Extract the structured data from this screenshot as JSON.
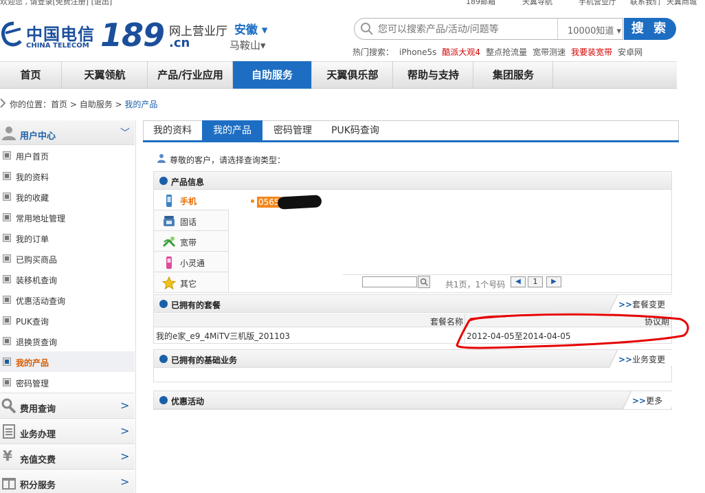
{
  "top_strip": {
    "items": [
      "欢迎您 , 请登录[免费注册] [退出]",
      "189邮箱",
      "天翼导航",
      "手机营业厅",
      "联系我们",
      "天翼商城"
    ]
  },
  "header": {
    "logo_cn": "中国电信",
    "logo_en": "CHINA TELECOM",
    "logo_189": "189",
    "hall_title": "网上营业厅",
    "hall_domain": ".cn",
    "province": "安徽 ▾",
    "city": "马鞍山▾"
  },
  "search": {
    "placeholder": "您可以搜索产品/活动/问题等",
    "scope": "10000知道 ▾",
    "button": "搜 索"
  },
  "hot_search": {
    "label": "热门搜索：",
    "items": [
      {
        "text": "iPhone5s",
        "red": false
      },
      {
        "text": "酷派大观4",
        "red": true
      },
      {
        "text": "整点抢流量",
        "red": false
      },
      {
        "text": "宽带测速",
        "red": false
      },
      {
        "text": "我要装宽带",
        "red": true
      },
      {
        "text": "安卓网",
        "red": false
      }
    ]
  },
  "nav": {
    "items": [
      "首页",
      "天翼领航",
      "产品/行业应用",
      "自助服务",
      "天翼俱乐部",
      "帮助与支持",
      "集团服务"
    ],
    "active_index": 3
  },
  "breadcrumb": {
    "prefix": "你的位置：",
    "items": [
      "首页",
      "自助服务",
      "我的产品"
    ],
    "separator": " > "
  },
  "sidebar": {
    "section_title": "用户中心",
    "items": [
      "用户首页",
      "我的资料",
      "我的收藏",
      "常用地址管理",
      "我的订单",
      "已购买商品",
      "装移机查询",
      "优惠活动查询",
      "PUK查询",
      "退换货查询",
      "我的产品",
      "密码管理"
    ],
    "active_index": 10,
    "sections": [
      {
        "label": "费用查询",
        "icon": "magnifier-icon"
      },
      {
        "label": "业务办理",
        "icon": "clipboard-icon"
      },
      {
        "label": "充值交费",
        "icon": "yen-icon"
      },
      {
        "label": "积分服务",
        "icon": "gift-icon"
      }
    ]
  },
  "tabs": {
    "items": [
      "我的资料",
      "我的产品",
      "密码管理",
      "PUK码查询"
    ],
    "active_index": 1
  },
  "main": {
    "greeting": "尊敬的客户，请选择查询类型：",
    "product_info": {
      "title": "产品信息",
      "types": [
        "手机",
        "固话",
        "宽带",
        "小灵通",
        "其它"
      ],
      "active_index": 0,
      "phone_number": "0565",
      "pager_text": "共1页，1个号码",
      "page": "1"
    },
    "packages": {
      "title": "已拥有的套餐",
      "more": "套餐变更",
      "columns": [
        "套餐名称",
        "协议期"
      ],
      "rows": [
        {
          "name": "我的e家_e9_4MiTV三机版_201103",
          "period": "2012-04-05至2014-04-05"
        }
      ]
    },
    "basic_services": {
      "title": "已拥有的基础业务",
      "more": "业务变更"
    },
    "promotions": {
      "title": "优惠活动",
      "more": "更多"
    }
  },
  "colors": {
    "brand_blue": "#1d6ec2",
    "active_orange": "#e86d00",
    "annotation_red": "#e60000"
  }
}
